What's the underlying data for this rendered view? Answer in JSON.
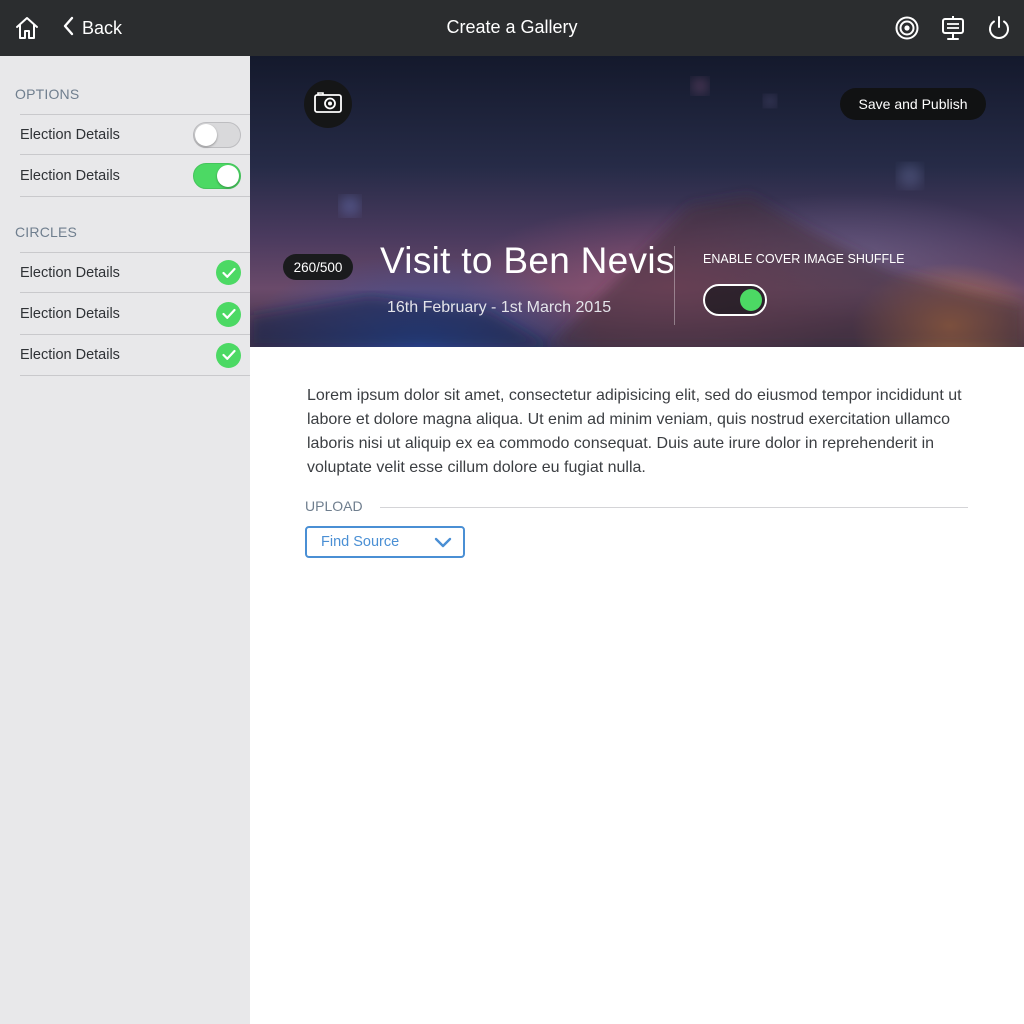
{
  "topbar": {
    "title": "Create a Gallery",
    "back_label": "Back",
    "icons": [
      "home-icon",
      "chevron-left-icon",
      "target-icon",
      "presentation-board-icon",
      "power-icon"
    ]
  },
  "sidebar": {
    "options_header": "OPTIONS",
    "options": [
      {
        "label": "Election Details",
        "enabled": false
      },
      {
        "label": "Election Details",
        "enabled": true
      }
    ],
    "circles_header": "CIRCLES",
    "circles": [
      {
        "label": "Election Details",
        "checked": true
      },
      {
        "label": "Election Details",
        "checked": true
      },
      {
        "label": "Election Details",
        "checked": true
      }
    ]
  },
  "hero": {
    "publish_label": "Save and Publish",
    "counter": "260/500",
    "gallery_title": "Visit to Ben Nevis",
    "dates": "16th February - 1st March 2015",
    "shuffle_label": "ENABLE COVER IMAGE SHUFFLE",
    "shuffle_enabled": true
  },
  "content": {
    "description": "Lorem ipsum dolor sit amet, consectetur adipisicing elit, sed do eiusmod tempor incididunt ut labore et dolore magna aliqua. Ut enim ad minim veniam, quis nostrud exercitation ullamco laboris nisi ut aliquip ex ea commodo consequat. Duis aute irure dolor in reprehenderit in voluptate velit esse cillum dolore eu fugiat nulla.",
    "upload_label": "UPLOAD",
    "source_select": "Find Source"
  },
  "colors": {
    "topbar": "#2b2d2f",
    "sidebar": "#e8e8ea",
    "toggle_on": "#4cd964",
    "link_blue": "#4a8fd4",
    "section_header": "#6f7e8e"
  }
}
